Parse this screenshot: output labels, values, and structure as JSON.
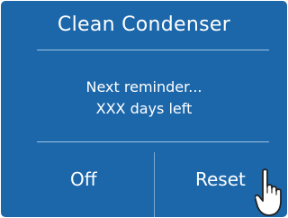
{
  "dialog": {
    "title": "Clean Condenser",
    "message_line1": "Next reminder...",
    "message_line2": "XXX days left"
  },
  "buttons": {
    "off_label": "Off",
    "reset_label": "Reset"
  },
  "colors": {
    "background": "#1c67aa",
    "text": "#ffffff",
    "divider": "#9fc1e0"
  },
  "icons": {
    "cursor": "pointing-hand-icon"
  }
}
